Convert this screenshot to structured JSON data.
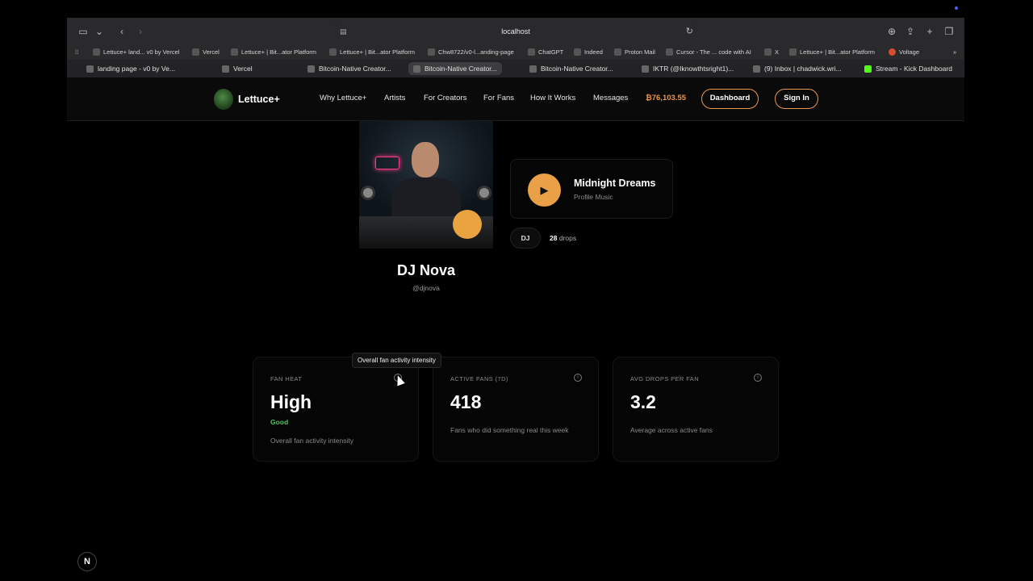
{
  "browser": {
    "url": "localhost",
    "favorites": [
      {
        "label": "Lettuce+ land... v0 by Vercel"
      },
      {
        "label": "Vercel"
      },
      {
        "label": "Lettuce+ | Bit...ator Platform"
      },
      {
        "label": "Lettuce+ | Bit...ator Platform"
      },
      {
        "label": "Chw8722/v0-l...anding-page"
      },
      {
        "label": "ChatGPT"
      },
      {
        "label": "Indeed"
      },
      {
        "label": "Proton Mail"
      },
      {
        "label": "Cursor - The ... code with AI"
      },
      {
        "label": "X"
      },
      {
        "label": "Lettuce+ | Bit...ator Platform"
      },
      {
        "label": "Voltage"
      }
    ],
    "tabs": [
      {
        "label": "landing page - v0 by Ve..."
      },
      {
        "label": "Vercel"
      },
      {
        "label": "Bitcoin-Native Creator..."
      },
      {
        "label": "Bitcoin-Native Creator..."
      },
      {
        "label": "Bitcoin-Native Creator..."
      },
      {
        "label": "IKTR (@Iknowthtsright1)..."
      },
      {
        "label": "(9) Inbox | chadwick.wri..."
      },
      {
        "label": "Stream - Kick Dashboard"
      }
    ]
  },
  "site": {
    "brand": "Lettuce+",
    "nav": {
      "why": "Why Lettuce+",
      "artists": "Artists",
      "creators": "For Creators",
      "fans": "For Fans",
      "how": "How It Works",
      "messages": "Messages",
      "balance": "₿76,103.55"
    },
    "dashboard_label": "Dashboard",
    "signin_label": "Sign In"
  },
  "profile": {
    "name": "DJ Nova",
    "handle": "@djnova",
    "track_title": "Midnight Dreams",
    "track_subtitle": "Profile Music",
    "genre": "DJ",
    "drops_count": "28",
    "drops_label": "drops"
  },
  "stats": [
    {
      "label": "FAN HEAT",
      "value": "High",
      "tag": "Good",
      "desc": "Overall fan activity intensity"
    },
    {
      "label": "ACTIVE FANS (7D)",
      "value": "418",
      "desc": "Fans who did something real this week"
    },
    {
      "label": "AVG DROPS PER FAN",
      "value": "3.2",
      "desc": "Average across active fans"
    }
  ],
  "tooltip": "Overall fan activity intensity",
  "next_badge": "N",
  "colors": {
    "accent": "#e9974b",
    "good": "#4cc262",
    "background": "#000000"
  }
}
